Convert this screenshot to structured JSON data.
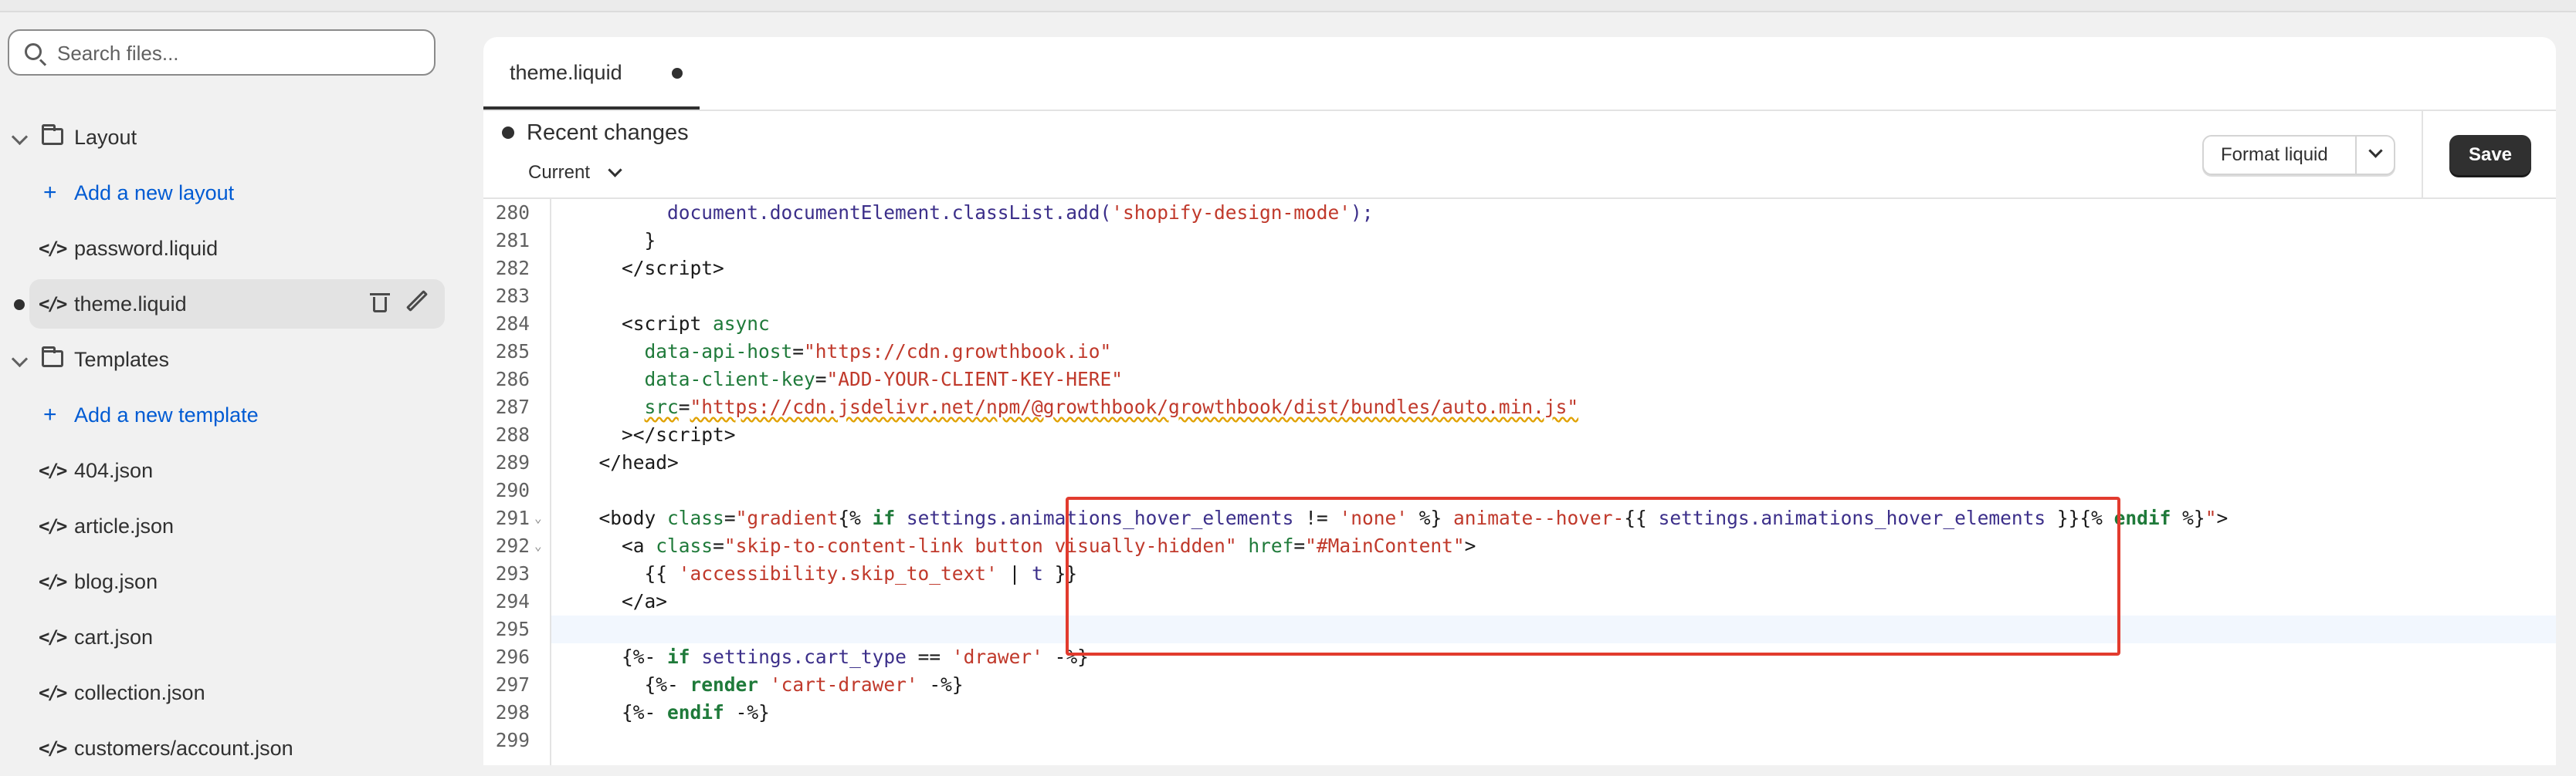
{
  "sidebar": {
    "search": {
      "placeholder": "Search files..."
    },
    "layout_folder": "Layout",
    "add_layout": "Add a new layout",
    "files_layout": [
      "password.liquid",
      "theme.liquid"
    ],
    "templates_folder": "Templates",
    "add_template": "Add a new template",
    "files_templates": [
      "404.json",
      "article.json",
      "blog.json",
      "cart.json",
      "collection.json",
      "customers/account.json"
    ]
  },
  "tab": {
    "label": "theme.liquid"
  },
  "changes": {
    "title": "Recent changes",
    "current": "Current"
  },
  "toolbar": {
    "format_label": "Format liquid",
    "save_label": "Save"
  },
  "editor": {
    "line_numbers": [
      "280",
      "281",
      "282",
      "283",
      "284",
      "285",
      "286",
      "287",
      "288",
      "289",
      "290",
      "291",
      "292",
      "293",
      "294",
      "295",
      "296",
      "297",
      "298",
      "299"
    ],
    "active_line": "295"
  },
  "icons": [
    "search-icon",
    "chevron-down-icon",
    "folder-icon",
    "plus-icon",
    "code-icon",
    "trash-icon",
    "pencil-icon",
    "dot-icon"
  ]
}
